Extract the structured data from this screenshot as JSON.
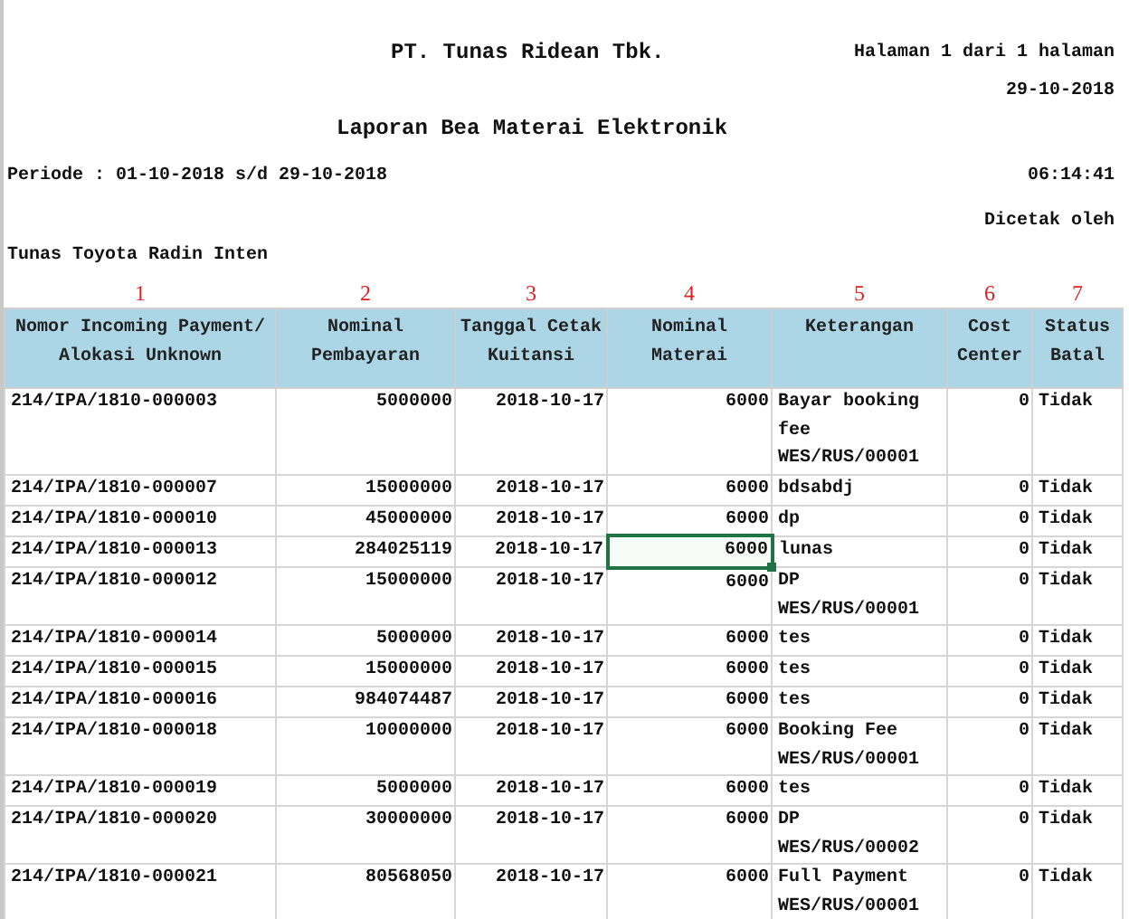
{
  "report": {
    "company": "PT. Tunas Ridean Tbk.",
    "page_info": "Halaman  1 dari  1 halaman",
    "date": "29-10-2018",
    "title": "Laporan Bea Materai Elektronik",
    "period": "Periode : 01-10-2018 s/d 29-10-2018",
    "time": "06:14:41",
    "printed_by": "Dicetak oleh",
    "branch": "Tunas Toyota Radin Inten"
  },
  "table": {
    "columns": [
      {
        "number": "1",
        "label": "Nomor Incoming Payment/\nAlokasi Unknown"
      },
      {
        "number": "2",
        "label": "Nominal\nPembayaran"
      },
      {
        "number": "3",
        "label": "Tanggal Cetak\nKuitansi"
      },
      {
        "number": "4",
        "label": "Nominal\nMaterai"
      },
      {
        "number": "5",
        "label": "Keterangan"
      },
      {
        "number": "6",
        "label": "Cost\nCenter"
      },
      {
        "number": "7",
        "label": "Status\nBatal"
      }
    ],
    "rows": [
      {
        "cells": [
          {
            "text": "214/IPA/1810-000003",
            "selected": false
          },
          {
            "text": "5000000",
            "selected": false
          },
          {
            "text": "2018-10-17",
            "selected": false
          },
          {
            "text": "6000",
            "selected": false
          },
          {
            "text": "Bayar booking\nfee\nWES/RUS/00001",
            "selected": false
          },
          {
            "text": "0",
            "selected": false
          },
          {
            "text": "Tidak",
            "selected": false
          }
        ]
      },
      {
        "cells": [
          {
            "text": "214/IPA/1810-000007",
            "selected": false
          },
          {
            "text": "15000000",
            "selected": false
          },
          {
            "text": "2018-10-17",
            "selected": false
          },
          {
            "text": "6000",
            "selected": false
          },
          {
            "text": "bdsabdj",
            "selected": false
          },
          {
            "text": "0",
            "selected": false
          },
          {
            "text": "Tidak",
            "selected": false
          }
        ]
      },
      {
        "cells": [
          {
            "text": "214/IPA/1810-000010",
            "selected": false
          },
          {
            "text": "45000000",
            "selected": false
          },
          {
            "text": "2018-10-17",
            "selected": false
          },
          {
            "text": "6000",
            "selected": false
          },
          {
            "text": "dp",
            "selected": false
          },
          {
            "text": "0",
            "selected": false
          },
          {
            "text": "Tidak",
            "selected": false
          }
        ]
      },
      {
        "cells": [
          {
            "text": "214/IPA/1810-000013",
            "selected": false
          },
          {
            "text": "284025119",
            "selected": false
          },
          {
            "text": "2018-10-17",
            "selected": false
          },
          {
            "text": "6000",
            "selected": true
          },
          {
            "text": "lunas",
            "selected": false
          },
          {
            "text": "0",
            "selected": false
          },
          {
            "text": "Tidak",
            "selected": false
          }
        ]
      },
      {
        "cells": [
          {
            "text": "214/IPA/1810-000012",
            "selected": false
          },
          {
            "text": "15000000",
            "selected": false
          },
          {
            "text": "2018-10-17",
            "selected": false
          },
          {
            "text": "6000",
            "selected": false
          },
          {
            "text": "DP\nWES/RUS/00001",
            "selected": false
          },
          {
            "text": "0",
            "selected": false
          },
          {
            "text": "Tidak",
            "selected": false
          }
        ]
      },
      {
        "cells": [
          {
            "text": "214/IPA/1810-000014",
            "selected": false
          },
          {
            "text": "5000000",
            "selected": false
          },
          {
            "text": "2018-10-17",
            "selected": false
          },
          {
            "text": "6000",
            "selected": false
          },
          {
            "text": "tes",
            "selected": false
          },
          {
            "text": "0",
            "selected": false
          },
          {
            "text": "Tidak",
            "selected": false
          }
        ]
      },
      {
        "cells": [
          {
            "text": "214/IPA/1810-000015",
            "selected": false
          },
          {
            "text": "15000000",
            "selected": false
          },
          {
            "text": "2018-10-17",
            "selected": false
          },
          {
            "text": "6000",
            "selected": false
          },
          {
            "text": "tes",
            "selected": false
          },
          {
            "text": "0",
            "selected": false
          },
          {
            "text": "Tidak",
            "selected": false
          }
        ]
      },
      {
        "cells": [
          {
            "text": "214/IPA/1810-000016",
            "selected": false
          },
          {
            "text": "984074487",
            "selected": false
          },
          {
            "text": "2018-10-17",
            "selected": false
          },
          {
            "text": "6000",
            "selected": false
          },
          {
            "text": "tes",
            "selected": false
          },
          {
            "text": "0",
            "selected": false
          },
          {
            "text": "Tidak",
            "selected": false
          }
        ]
      },
      {
        "cells": [
          {
            "text": "214/IPA/1810-000018",
            "selected": false
          },
          {
            "text": "10000000",
            "selected": false
          },
          {
            "text": "2018-10-17",
            "selected": false
          },
          {
            "text": "6000",
            "selected": false
          },
          {
            "text": "Booking Fee\nWES/RUS/00001",
            "selected": false
          },
          {
            "text": "0",
            "selected": false
          },
          {
            "text": "Tidak",
            "selected": false
          }
        ]
      },
      {
        "cells": [
          {
            "text": "214/IPA/1810-000019",
            "selected": false
          },
          {
            "text": "5000000",
            "selected": false
          },
          {
            "text": "2018-10-17",
            "selected": false
          },
          {
            "text": "6000",
            "selected": false
          },
          {
            "text": "tes",
            "selected": false
          },
          {
            "text": "0",
            "selected": false
          },
          {
            "text": "Tidak",
            "selected": false
          }
        ]
      },
      {
        "cells": [
          {
            "text": "214/IPA/1810-000020",
            "selected": false
          },
          {
            "text": "30000000",
            "selected": false
          },
          {
            "text": "2018-10-17",
            "selected": false
          },
          {
            "text": "6000",
            "selected": false
          },
          {
            "text": "DP\nWES/RUS/00002",
            "selected": false
          },
          {
            "text": "0",
            "selected": false
          },
          {
            "text": "Tidak",
            "selected": false
          }
        ]
      },
      {
        "cells": [
          {
            "text": "214/IPA/1810-000021",
            "selected": false
          },
          {
            "text": "80568050",
            "selected": false
          },
          {
            "text": "2018-10-17",
            "selected": false
          },
          {
            "text": "6000",
            "selected": false
          },
          {
            "text": "Full Payment\nWES/RUS/00001",
            "selected": false
          },
          {
            "text": "0",
            "selected": false
          },
          {
            "text": "Tidak",
            "selected": false
          }
        ]
      }
    ]
  }
}
